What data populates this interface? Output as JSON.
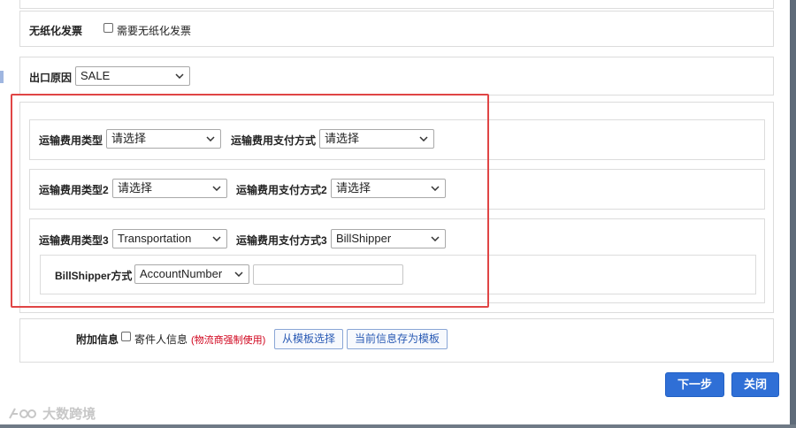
{
  "paperless": {
    "label": "无纸化发票",
    "checkbox_label": "需要无纸化发票",
    "checked": false
  },
  "export_reason": {
    "label": "出口原因",
    "selected": "SALE"
  },
  "shipping_fee": {
    "row1": {
      "type_label": "运输费用类型",
      "type_selected": "请选择",
      "payment_label": "运输费用支付方式",
      "payment_selected": "请选择"
    },
    "row2": {
      "type_label": "运输费用类型2",
      "type_selected": "请选择",
      "payment_label": "运输费用支付方式2",
      "payment_selected": "请选择"
    },
    "row3": {
      "type_label": "运输费用类型3",
      "type_selected": "Transportation",
      "payment_label": "运输费用支付方式3",
      "payment_selected": "BillShipper",
      "billshipper": {
        "label": "BillShipper方式",
        "selected": "AccountNumber",
        "value": ""
      }
    }
  },
  "additional_info": {
    "label": "附加信息",
    "sender_label": "寄件人信息",
    "sender_checked": false,
    "note": "(物流商强制使用)",
    "from_template_button": "从模板选择",
    "save_template_button": "当前信息存为模板"
  },
  "footer": {
    "next_button": "下一步",
    "close_button": "关闭"
  },
  "watermark": {
    "text": "大数跨境"
  },
  "colors": {
    "primary": "#2f6fd6",
    "highlight_border": "#e04545",
    "note_red": "#d0021b"
  }
}
